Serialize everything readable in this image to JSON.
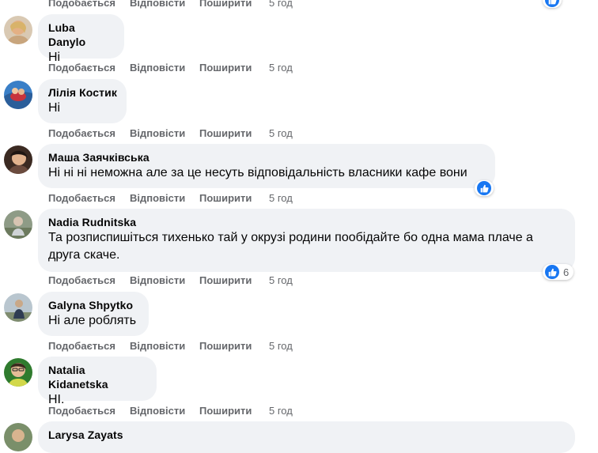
{
  "actions": {
    "like": "Подобається",
    "reply": "Відповісти",
    "share": "Поширити"
  },
  "top_actions": {
    "like": "Подобається",
    "reply": "Відповісти",
    "share": "Поширити",
    "time": "5 год"
  },
  "comments": [
    {
      "author": "Luba Danylo",
      "text": "Ні",
      "time": "5 год"
    },
    {
      "author": "Лілія Костик",
      "text": "Ні",
      "time": "5 год"
    },
    {
      "author": "Маша Заячківська",
      "text": "Ні ні ні неможна але за це несуть відповідальність власники кафе вони",
      "time": "5 год",
      "reaction_icon": "like-icon"
    },
    {
      "author": "Nadia Rudnitska",
      "text": "Та розписпишіться тихенько тай у окрузі родини пообідайте бо одна мама плаче а друга скаче.",
      "time": "5 год",
      "reaction_icon": "like-icon",
      "reaction_count": "6"
    },
    {
      "author": "Galyna Shpytko",
      "text": "Ні але роблять",
      "time": "5 год"
    },
    {
      "author": "Natalia Kidanetska",
      "text": "HI.",
      "time": "5 год"
    },
    {
      "author": "Larysa Zayats"
    }
  ],
  "colors": {
    "bubble": "#f0f2f5",
    "meta": "#65676b",
    "like": "#1877f2",
    "text": "#050505"
  }
}
